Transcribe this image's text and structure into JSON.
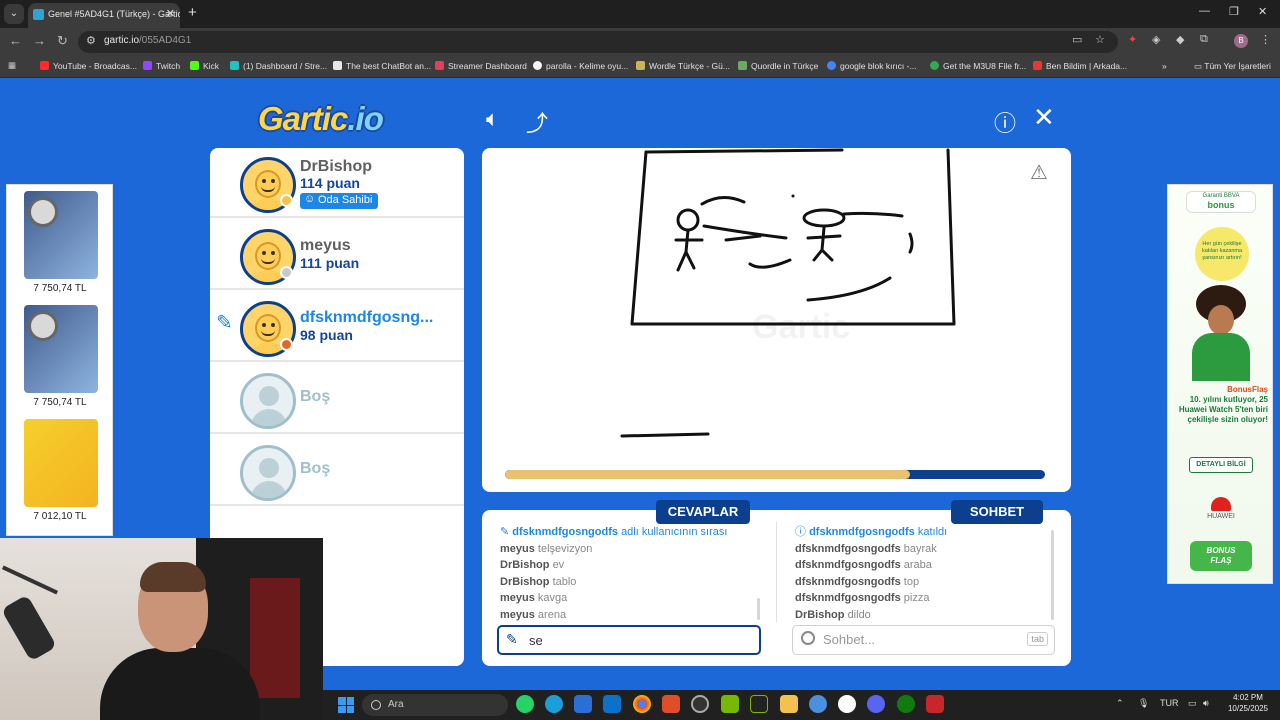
{
  "browser": {
    "tab_title": "Genel #5AD4G1 (Türkçe) - Gartic",
    "url_host": "gartic.io",
    "url_path": "/055AD4G1",
    "profile_initial": "B",
    "bookmarks": [
      {
        "label": "YouTube - Broadcas...",
        "color": "#ff2a2a"
      },
      {
        "label": "Twitch",
        "color": "#9146ff"
      },
      {
        "label": "Kick",
        "color": "#53fc18"
      },
      {
        "label": "(1) Dashboard / Stre...",
        "color": "#22c1c3"
      },
      {
        "label": "The best ChatBot an...",
        "color": "#e8e8e8"
      },
      {
        "label": "Streamer Dashboard",
        "color": "#e53e5a"
      },
      {
        "label": "parolla - Kelime oyu...",
        "color": "#f5f5f5"
      },
      {
        "label": "Wordle Türkçe - Gü...",
        "color": "#c9b458"
      },
      {
        "label": "Quordle in Türkçe",
        "color": "#6aaa64"
      },
      {
        "label": "google blok kırıcı -...",
        "color": "#4285f4"
      },
      {
        "label": "Get the M3U8 File fr...",
        "color": "#34a853"
      },
      {
        "label": "Ben Bildim | Arkada...",
        "color": "#e53935"
      }
    ],
    "all_bookmarks_label": "Tüm Yer İşaretleri"
  },
  "game": {
    "logo_main": "Gartic",
    "logo_suffix": ".io",
    "players": [
      {
        "name": "DrBishop",
        "score": "114 puan",
        "badge": "Oda Sahibi",
        "status_color": "#f5c242",
        "drawing": false
      },
      {
        "name": "meyus",
        "score": "111 puan",
        "status_color": "#c8c8c8",
        "drawing": false
      },
      {
        "name": "dfsknmdfgosng...",
        "score": "98 puan",
        "status_color": "#e2682a",
        "drawing": true
      }
    ],
    "empty_slots": [
      "Boş",
      "Boş"
    ],
    "progress": 0.75,
    "answers_label": "CEVAPLAR",
    "chat_label": "SOHBET",
    "answers": [
      {
        "system": true,
        "user": "dfsknmdfgosngodfs",
        "text": "adlı kullanıcının sırası"
      },
      {
        "user": "meyus",
        "text": "telşevizyon"
      },
      {
        "user": "DrBishop",
        "text": "ev"
      },
      {
        "user": "DrBishop",
        "text": "tablo"
      },
      {
        "user": "meyus",
        "text": "kavga"
      },
      {
        "user": "meyus",
        "text": "arena"
      }
    ],
    "chat": [
      {
        "system": true,
        "user": "dfsknmdfgosngodfs",
        "text": "katıldı"
      },
      {
        "user": "dfsknmdfgosngodfs",
        "text": "bayrak"
      },
      {
        "user": "dfsknmdfgosngodfs",
        "text": "araba"
      },
      {
        "user": "dfsknmdfgosngodfs",
        "text": "top"
      },
      {
        "user": "dfsknmdfgosngodfs",
        "text": "pizza"
      },
      {
        "user": "DrBishop",
        "text": "dildo"
      }
    ],
    "answer_value": "se",
    "chat_placeholder": "Sohbet...",
    "tab_hint": "tab"
  },
  "ads": {
    "left_prices": [
      "7 750,74 TL",
      "7 750,74 TL",
      "7 012,10 TL"
    ],
    "right": {
      "brand_top": "Garanti BBVA",
      "brand_name": "bonus",
      "circle_text": "Her gün çekilişe katılan kazanma şansınızı artırın!",
      "promo_title": "BonusFlaş",
      "promo_text": "10. yılını kutluyor, 25 Huawei Watch 5'ten biri çekilişle sizin oluyor!",
      "cta": "DETAYLI BİLGİ",
      "sponsor": "HUAWEI",
      "footer_a": "BONUS",
      "footer_b": "FLAŞ"
    }
  },
  "taskbar": {
    "search_label": "Ara",
    "language": "TUR",
    "time": "4:02 PM",
    "date": "10/25/2025"
  }
}
